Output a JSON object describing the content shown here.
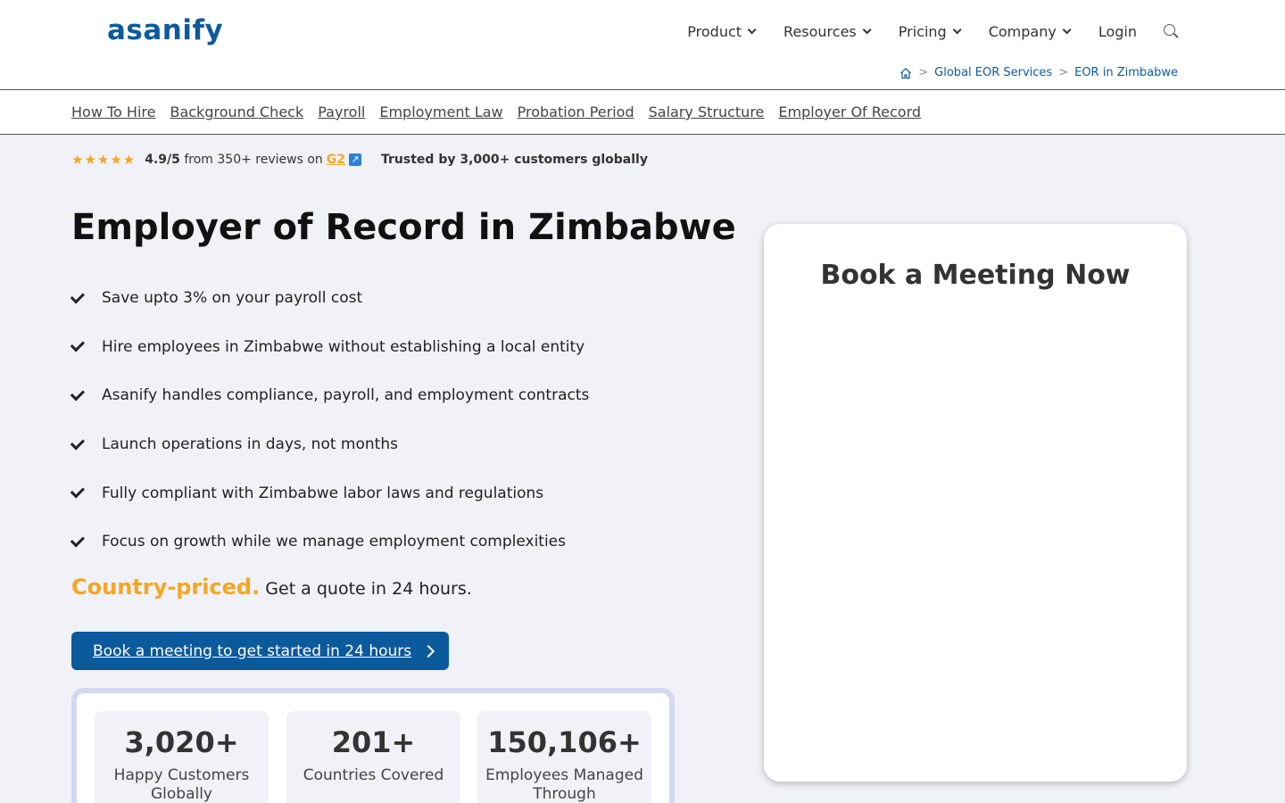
{
  "header": {
    "logo": "asanify",
    "nav": [
      {
        "label": "Product",
        "has_dropdown": true
      },
      {
        "label": "Resources",
        "has_dropdown": true
      },
      {
        "label": "Pricing",
        "has_dropdown": true
      },
      {
        "label": "Company",
        "has_dropdown": true
      }
    ],
    "login": "Login",
    "search_icon": "search-icon"
  },
  "breadcrumb": {
    "home_icon": "home-icon",
    "items": [
      "Global EOR Services",
      "EOR in Zimbabwe"
    ],
    "separator": ">"
  },
  "subnav": [
    "How To Hire",
    "Background Check",
    "Payroll",
    "Employment Law",
    "Probation Period",
    "Salary Structure",
    "Employer Of Record"
  ],
  "rating": {
    "stars": "★★★★★",
    "score": "4.9/5",
    "text": "from 350+ reviews on",
    "source": "G2",
    "trusted": "Trusted by 3,000+ customers globally"
  },
  "hero": {
    "title": "Employer of Record in Zimbabwe",
    "features": [
      "Save upto 3% on your payroll cost",
      "Hire employees in Zimbabwe without establishing a local entity",
      "Asanify handles compliance, payroll, and employment contracts",
      "Launch operations in days, not months",
      "Fully compliant with Zimbabwe labor laws and regulations",
      "Focus on growth while we manage employment complexities"
    ],
    "priced_accent": "Country-priced.",
    "priced_text": "Get a quote in 24 hours.",
    "cta": "Book a meeting to get started in 24 hours"
  },
  "stats": [
    {
      "number": "3,020+",
      "label": "Happy Customers Globally"
    },
    {
      "number": "201+",
      "label": "Countries Covered"
    },
    {
      "number": "150,106+",
      "label": "Employees Managed Through"
    }
  ],
  "meeting_card": {
    "title": "Book a Meeting Now"
  },
  "colors": {
    "brand": "#0b5a9c",
    "accent": "#f5a623",
    "background": "#f1f2f7"
  }
}
